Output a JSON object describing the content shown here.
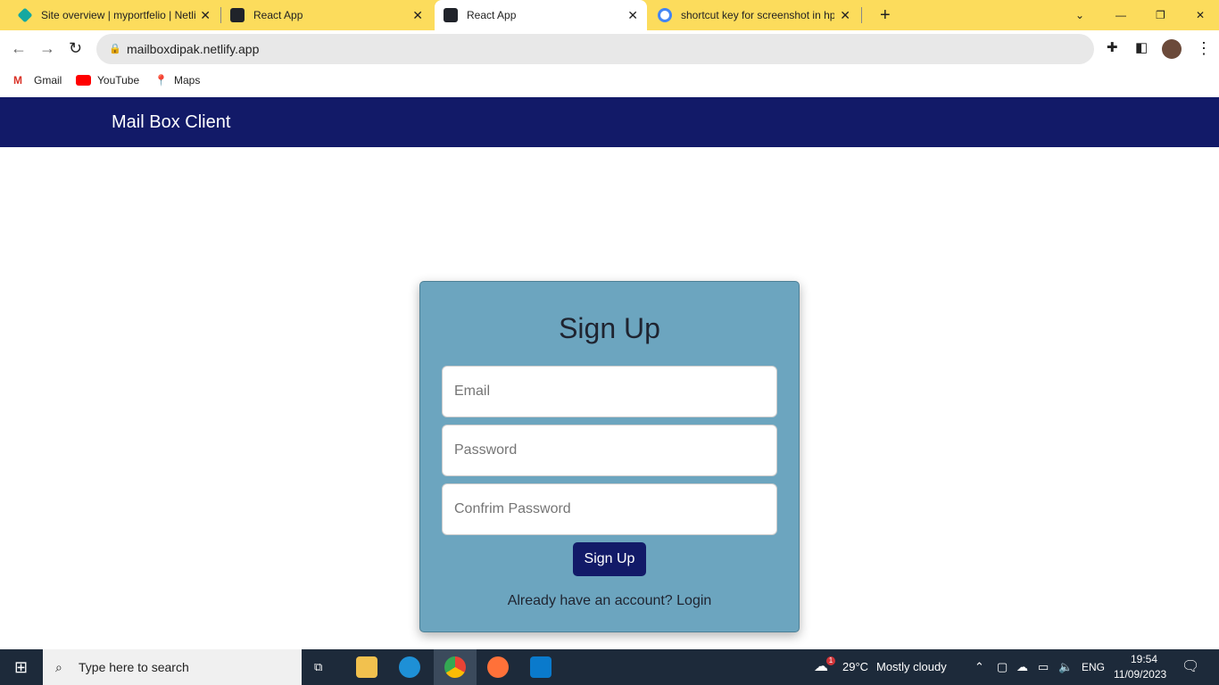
{
  "browser": {
    "tabs": [
      {
        "title": "Site overview | myportfelio | Netli",
        "icon": "netlify-icon"
      },
      {
        "title": "React App",
        "icon": "react-icon"
      },
      {
        "title": "React App",
        "icon": "react-icon",
        "active": true
      },
      {
        "title": "shortcut key for screenshot in hp",
        "icon": "google-icon"
      }
    ],
    "url": "mailboxdipak.netlify.app",
    "bookmarks": [
      "Gmail",
      "YouTube",
      "Maps"
    ]
  },
  "header": {
    "brand": "Mail Box Client"
  },
  "form": {
    "title": "Sign Up",
    "email_placeholder": "Email",
    "password_placeholder": "Password",
    "confirm_placeholder": "Confrim Password",
    "submit": "Sign Up",
    "login_text": "Already have an account? Login"
  },
  "colors": {
    "navbar": "#121a68",
    "card": "#6ca5bf",
    "tabbar": "#fcdc5c"
  },
  "taskbar": {
    "search_placeholder": "Type here to search",
    "temperature": "29°C",
    "weather": "Mostly cloudy",
    "weather_badge": "1",
    "language": "ENG",
    "time": "19:54",
    "date": "11/09/2023"
  }
}
